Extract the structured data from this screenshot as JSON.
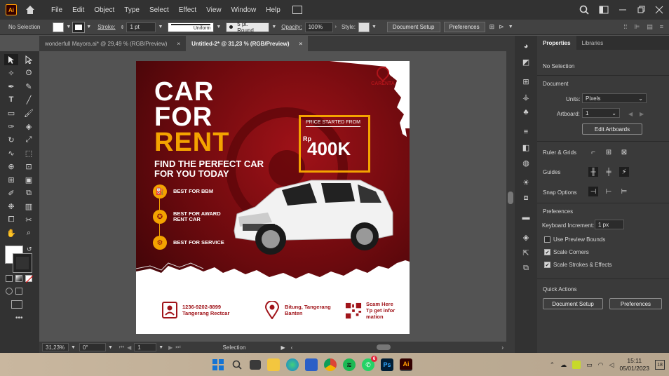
{
  "app": {
    "logo": "Ai",
    "accent": "#ff9a00"
  },
  "menu": [
    "File",
    "Edit",
    "Object",
    "Type",
    "Select",
    "Effect",
    "View",
    "Window",
    "Help"
  ],
  "control_bar": {
    "selection": "No Selection",
    "stroke_label": "Stroke:",
    "stroke_value": "1 pt",
    "profile": "Uniform",
    "brush": "5 pt. Round",
    "opacity_label": "Opacity:",
    "opacity_value": "100%",
    "style_label": "Style:",
    "document_setup": "Document Setup",
    "preferences": "Preferences"
  },
  "tabs": [
    {
      "label": "wonderfull Mayora.ai* @ 29,49 % (RGB/Preview)",
      "active": false
    },
    {
      "label": "Untitled-2* @ 31,23 % (RGB/Preview)",
      "active": true
    }
  ],
  "artboard": {
    "headline_1": "CAR",
    "headline_2": "FOR",
    "headline_3": "RENT",
    "subtitle_1": "FIND THE PERFECT CAR",
    "subtitle_2": "FOR YOU TODAY",
    "brand": "CARENTA",
    "price_label": "PRICE STARTED FROM",
    "price_currency": "Rp",
    "price_value": "400K",
    "features": [
      "BEST FOR BBM",
      "BEST FOR AWARD RENT CAR",
      "BEST FOR SERVICE"
    ],
    "contact_phone_1": "1236-9202-8899",
    "contact_phone_2": "Tangerang Rectcar",
    "contact_location_1": "Bitung, Tangerang",
    "contact_location_2": "Banten",
    "contact_qr_1": "Scam Here",
    "contact_qr_2": "Tp get infor",
    "contact_qr_3": "mation",
    "colors": {
      "red": "#8a0c10",
      "gold": "#f4a300"
    }
  },
  "status_bar": {
    "zoom": "31,23%",
    "rotation": "0°",
    "artboard_num": "1",
    "mode": "Selection"
  },
  "panel": {
    "tab_properties": "Properties",
    "tab_libraries": "Libraries",
    "no_selection": "No Selection",
    "document": "Document",
    "units_label": "Units:",
    "units_value": "Pixels",
    "artboard_label": "Artboard:",
    "artboard_value": "1",
    "edit_artboards": "Edit Artboards",
    "rulers_grids": "Ruler & Grids",
    "guides": "Guides",
    "snap_options": "Snap Options",
    "preferences": "Preferences",
    "keyboard_increment_label": "Keyboard Increment:",
    "keyboard_increment_value": "1 px",
    "use_preview_bounds": "Use Preview Bounds",
    "scale_corners": "Scale Corners",
    "scale_strokes": "Scale Strokes & Effects",
    "quick_actions": "Quick Actions",
    "btn_document_setup": "Document Setup",
    "btn_preferences": "Preferences"
  },
  "taskbar": {
    "time": "15:11",
    "date": "05/01/2023",
    "notification_count": "18",
    "whatsapp_badge": "6"
  }
}
